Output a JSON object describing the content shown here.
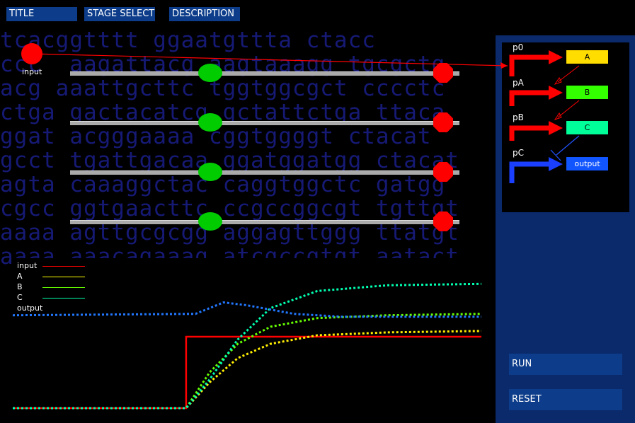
{
  "nav": {
    "title_label": "TITLE",
    "stage_select_label": "STAGE SELECT",
    "description_label": "DESCRIPTION"
  },
  "input": {
    "label": "input"
  },
  "sliders": [
    {
      "name": "slider-1",
      "value_fraction": 0.36
    },
    {
      "name": "slider-2",
      "value_fraction": 0.36
    },
    {
      "name": "slider-3",
      "value_fraction": 0.36
    },
    {
      "name": "slider-4",
      "value_fraction": 0.36
    }
  ],
  "background_sequence": [
    "tcacggtttt ggaatgttta ctacc",
    "ccc  aagattacg aagtaaagg tgcgctg",
    "acg aaattgcttc tggtggcgct cccctc",
    "ctga gactacatcg gctattctga ttaca",
    "ggat acgggaaaa cggtggggt ctacat",
    "gcct tgattgacaa ggatggatgg ctacat",
    "agta caaaggctac caggtggctc gatgg",
    "cgcc ggtgaacttc ccgccggcgt tgttgt",
    "aaaa agttgcgcgg aggagttggg ttatgt",
    "aaaa aaacagaaag atcgccgtgt aatact"
  ],
  "legend": {
    "input": "input",
    "a": "A",
    "b": "B",
    "c": "C",
    "output": "output"
  },
  "circuit": {
    "promoters": [
      "p0",
      "pA",
      "pB",
      "pC"
    ],
    "genes": [
      "A",
      "B",
      "C",
      "output"
    ],
    "colors": {
      "A": "#ffdd00",
      "B": "#33ff00",
      "C": "#00ff99",
      "output": "#1155ff",
      "promoter": "#ff0000",
      "promoter_output": "#1a3fff"
    }
  },
  "chart_data": {
    "type": "line",
    "series": [
      {
        "name": "input",
        "color": "#ff0000",
        "style": "solid",
        "x": [
          0,
          0.37,
          0.37,
          1.0
        ],
        "y": [
          0,
          0,
          0.5,
          0.5
        ]
      },
      {
        "name": "A",
        "color": "#ffee00",
        "style": "dotted",
        "x": [
          0,
          0.37,
          0.42,
          0.48,
          0.55,
          0.65,
          0.8,
          1.0
        ],
        "y": [
          0,
          0,
          0.18,
          0.35,
          0.45,
          0.51,
          0.53,
          0.54
        ]
      },
      {
        "name": "B",
        "color": "#66ff00",
        "style": "dotted",
        "x": [
          0,
          0.37,
          0.42,
          0.48,
          0.55,
          0.65,
          0.8,
          1.0
        ],
        "y": [
          0,
          0,
          0.25,
          0.45,
          0.57,
          0.63,
          0.65,
          0.66
        ]
      },
      {
        "name": "C",
        "color": "#00ffb0",
        "style": "dotted",
        "x": [
          0,
          0.37,
          0.42,
          0.48,
          0.55,
          0.65,
          0.8,
          1.0
        ],
        "y": [
          0,
          0,
          0.2,
          0.48,
          0.7,
          0.82,
          0.86,
          0.87
        ]
      },
      {
        "name": "output",
        "color": "#2277ff",
        "style": "dotted",
        "x": [
          0,
          0.39,
          0.45,
          0.5,
          0.6,
          0.7,
          1.0
        ],
        "y": [
          0.65,
          0.66,
          0.74,
          0.72,
          0.66,
          0.64,
          0.64
        ]
      }
    ],
    "ylim": [
      0,
      1
    ],
    "xlim": [
      0,
      1
    ]
  },
  "buttons": {
    "run_label": "RUN",
    "reset_label": "RESET"
  }
}
